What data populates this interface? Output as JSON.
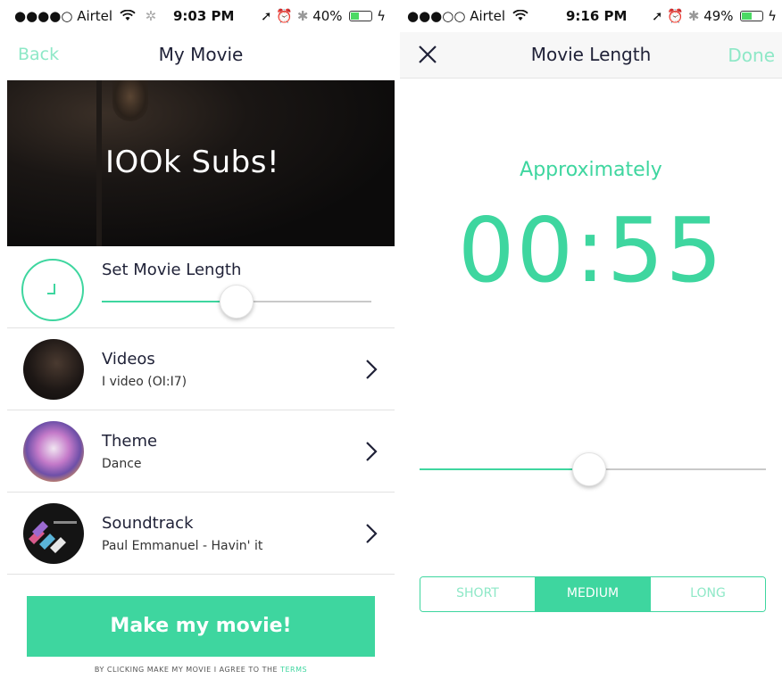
{
  "left": {
    "status": {
      "carrier": "●●●●○ Airtel",
      "time": "9:03 PM",
      "battery": "40%",
      "battery_level": 0.4
    },
    "nav": {
      "back_label": "Back",
      "title": "My Movie"
    },
    "hero": {
      "text": "IOOk Subs!"
    },
    "length": {
      "label": "Set Movie Length",
      "slider_value": 0.5
    },
    "rows": [
      {
        "title": "Videos",
        "subtitle": "I video (OI:I7)"
      },
      {
        "title": "Theme",
        "subtitle": "Dance"
      },
      {
        "title": "Soundtrack",
        "subtitle": "Paul Emmanuel - Havin' it"
      }
    ],
    "make_button": "Make my movie!",
    "terms_text": "BY CLICKING MAKE MY MOVIE I AGREE TO THE ",
    "terms_link": "TERMS"
  },
  "right": {
    "status": {
      "carrier": "●●●○○ Airtel",
      "time": "9:16 PM",
      "battery": "49%",
      "battery_level": 0.49
    },
    "nav": {
      "title": "Movie Length",
      "done_label": "Done"
    },
    "approx_label": "Approximately",
    "duration": "00:55",
    "slider_value": 0.49,
    "segments": [
      "SHORT",
      "MEDIUM",
      "LONG"
    ],
    "selected_segment": "MEDIUM"
  },
  "colors": {
    "accent": "#3ed69f",
    "accent_light": "#8ee8c7",
    "text_dark": "#1f2137"
  }
}
